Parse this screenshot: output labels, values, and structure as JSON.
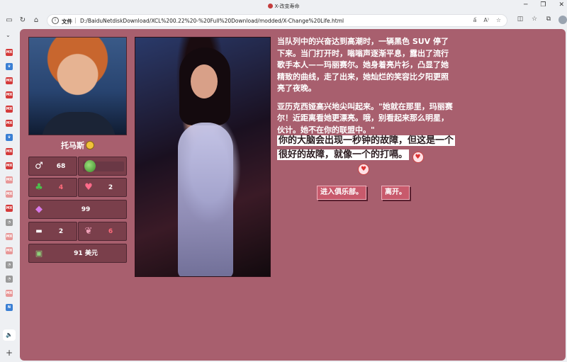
{
  "window": {
    "tab_title": "X-改变寿命",
    "controls": [
      "─",
      "❐",
      "✕"
    ]
  },
  "toolbar": {
    "address_scheme": "文件",
    "address_url": "D:/BaiduNetdiskDownload/XCL%200.22%20-%20Full%20Download/modded/X-Change%20Life.html",
    "address_icons": [
      "ấ",
      "A⁾",
      "☆"
    ]
  },
  "sidebar": {
    "items": [
      "MX",
      "♛",
      "MX",
      "MX",
      "MX",
      "MX",
      "♛",
      "MX",
      "MX",
      "MX",
      "MX",
      "MX",
      "◔",
      "MX",
      "MX",
      "◔",
      "◔",
      "MX",
      "N"
    ]
  },
  "player": {
    "name": "托马斯",
    "stats": {
      "gender_value": "68",
      "luck_value": "4",
      "love_value": "2",
      "gem_value": "99",
      "fitness_value": "2",
      "brain_value": "6",
      "money_value": "91 美元"
    }
  },
  "story": {
    "paragraph1": "当队列中的兴奋达到高潮时，一辆黑色 SUV 停了下来。当门打开时，嗡嗡声逐渐平息，露出了流行歌手本人——玛丽赛尔。她身着亮片衫，凸显了她精致的曲线，走了出来，她灿烂的笑容比夕阳更照亮了夜晚。",
    "paragraph2": "亚历克西娅高兴地尖叫起来。\"她就在那里，玛丽赛尔！近距离看她更漂亮。哦，别看起来那么明星，伙计。她不在你的联盟中。\"",
    "thought": "你的大脑会出现一秒钟的故障，但这是一个很好的故障，就像一个的打嗝。"
  },
  "actions": {
    "enter_club": "进入俱乐部。",
    "leave": "离开。"
  },
  "colors": {
    "page_bg": "#a85f6e",
    "stat_bg": "#7a3f4b",
    "button_bg": "#c85a6c",
    "stat_red": "#ff6b7a"
  }
}
